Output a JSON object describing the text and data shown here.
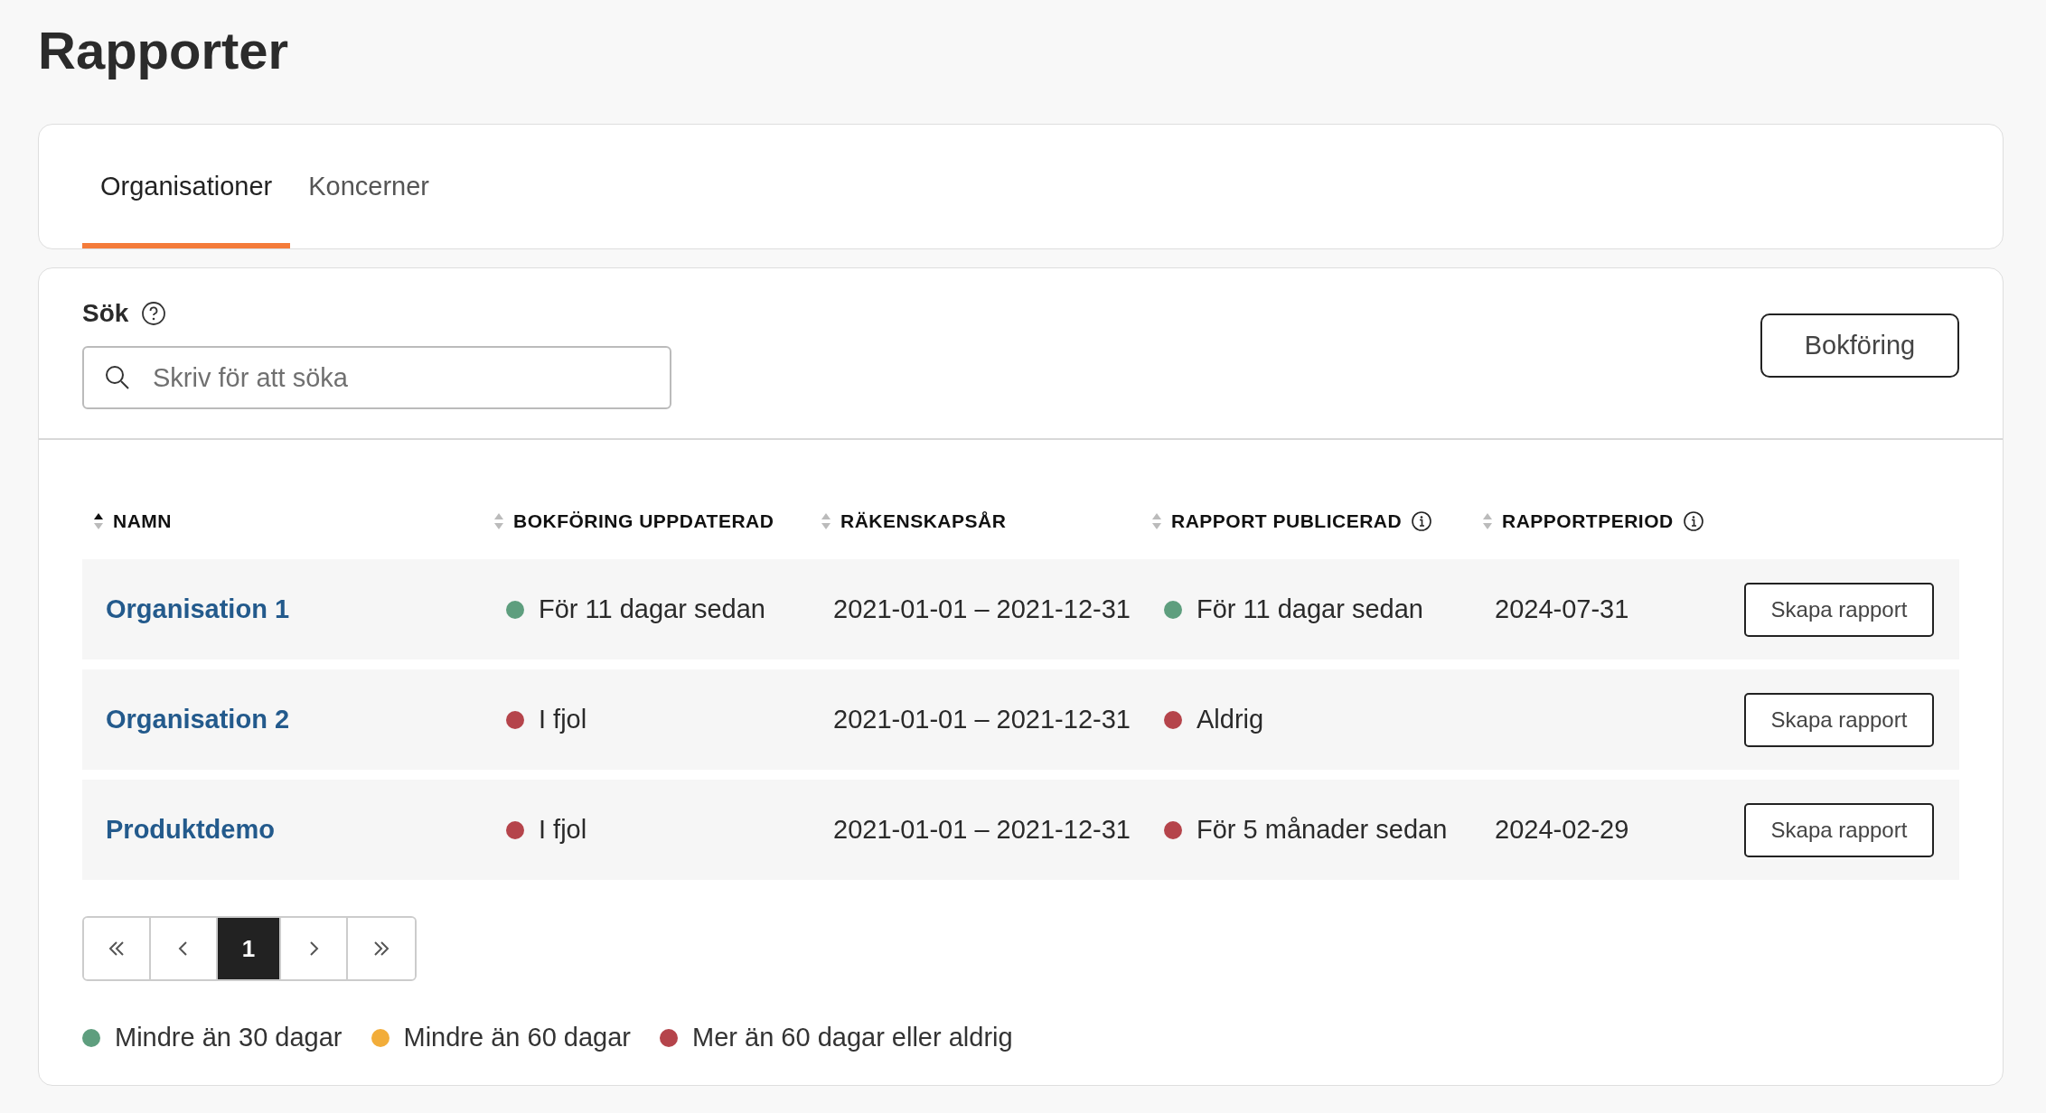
{
  "title": "Rapporter",
  "tabs": [
    {
      "label": "Organisationer",
      "selected": true
    },
    {
      "label": "Koncerner",
      "selected": false
    }
  ],
  "search": {
    "label": "Sök",
    "placeholder": "Skriv för att söka"
  },
  "bookkeeping_button": "Bokföring",
  "table": {
    "columns": [
      {
        "label": "NAMN",
        "sorted_ascending": true,
        "info": false
      },
      {
        "label": "BOKFÖRING UPPDATERAD",
        "sorted_ascending": false,
        "info": false
      },
      {
        "label": "RÄKENSKAPSÅR",
        "sorted_ascending": false,
        "info": false
      },
      {
        "label": "RAPPORT PUBLICERAD",
        "sorted_ascending": false,
        "info": true
      },
      {
        "label": "RAPPORTPERIOD",
        "sorted_ascending": false,
        "info": true
      }
    ],
    "rows": [
      {
        "name": "Organisation 1",
        "bookkeeping_updated": {
          "text": "För 11 dagar sedan",
          "color": "#5e9e7e"
        },
        "fiscal_year": "2021-01-01 – 2021-12-31",
        "report_published": {
          "text": "För 11 dagar sedan",
          "color": "#5e9e7e"
        },
        "report_period": "2024-07-31",
        "action": "Skapa rapport"
      },
      {
        "name": "Organisation 2",
        "bookkeeping_updated": {
          "text": "I fjol",
          "color": "#b5444b"
        },
        "fiscal_year": "2021-01-01 – 2021-12-31",
        "report_published": {
          "text": "Aldrig",
          "color": "#b5444b"
        },
        "action": "Skapa rapport"
      },
      {
        "name": "Produktdemo",
        "bookkeeping_updated": {
          "text": "I fjol",
          "color": "#b5444b"
        },
        "fiscal_year": "2021-01-01 – 2021-12-31",
        "report_published": {
          "text": "För 5 månader sedan",
          "color": "#b5444b"
        },
        "report_period": "2024-02-29",
        "action": "Skapa rapport"
      }
    ]
  },
  "pagination": {
    "pages": [
      {
        "label": "1",
        "selected": true
      }
    ]
  },
  "legend": [
    {
      "label": "Mindre än 30 dagar",
      "color": "#5e9e7e"
    },
    {
      "label": "Mindre än 60 dagar",
      "color": "#f2ad3a"
    },
    {
      "label": "Mer än 60 dagar eller aldrig",
      "color": "#b5444b"
    }
  ]
}
